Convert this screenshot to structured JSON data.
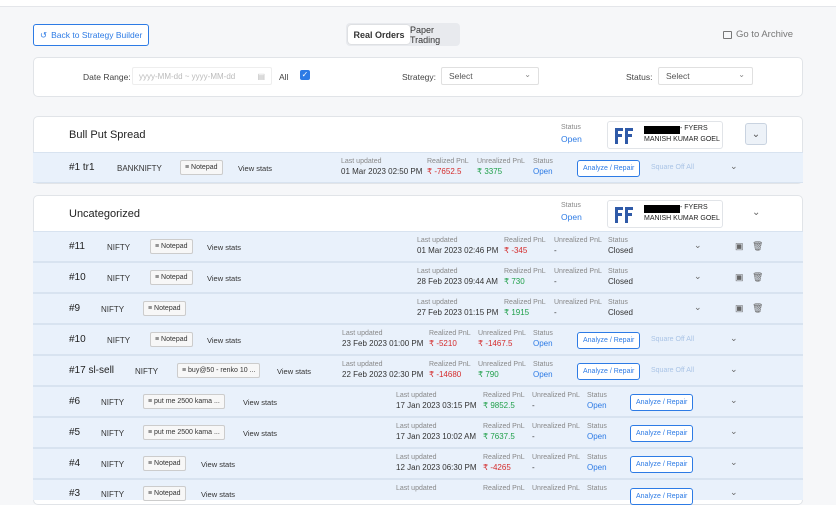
{
  "header": {
    "back_label": "Back to Strategy Builder",
    "tabs": [
      "Real Orders",
      "Paper Trading"
    ],
    "archive_label": "Go to Archive"
  },
  "filters": {
    "date_label": "Date Range:",
    "date_placeholder": "yyyy-MM-dd ~ yyyy-MM-dd",
    "all_label": "All",
    "strategy_label": "Strategy:",
    "strategy_value": "Select",
    "status_label": "Status:",
    "status_value": "Select"
  },
  "groups": [
    {
      "title": "Bull Put Spread",
      "status_label": "Status",
      "status": "Open",
      "broker_1": "- FYERS",
      "broker_2": "MANISH KUMAR GOEL"
    },
    {
      "title": "Uncategorized",
      "status_label": "Status",
      "status": "Open",
      "broker_1": "- FYERS",
      "broker_2": "MANISH KUMAR GOEL"
    }
  ],
  "labels": {
    "last_updated": "Last updated",
    "realized": "Realized PnL",
    "unrealized": "Unrealized PnL",
    "status": "Status",
    "view_stats": "View stats",
    "analyze": "Analyze / Repair",
    "square_off": "Square Off All"
  },
  "rows": [
    {
      "id": "#1 tr1",
      "sym": "BANKNIFTY",
      "note": "Notepad",
      "date": "01 Mar 2023 02:50 PM",
      "realized": "₹ -7652.5",
      "unrealized": "₹ 3375",
      "status": "Open"
    },
    {
      "id": "#11",
      "sym": "NIFTY",
      "note": "Notepad",
      "date": "01 Mar 2023 02:46 PM",
      "realized": "₹ -345",
      "unrealized": "-",
      "status": "Closed"
    },
    {
      "id": "#10",
      "sym": "NIFTY",
      "note": "Notepad",
      "date": "28 Feb 2023 09:44 AM",
      "realized": "₹ 730",
      "unrealized": "-",
      "status": "Closed"
    },
    {
      "id": "#9",
      "sym": "NIFTY",
      "note": "Notepad",
      "date": "27 Feb 2023 01:15 PM",
      "realized": "₹ 1915",
      "unrealized": "-",
      "status": "Closed"
    },
    {
      "id": "#10",
      "sym": "NIFTY",
      "note": "Notepad",
      "date": "23 Feb 2023 01:00 PM",
      "realized": "₹ -5210",
      "unrealized": "₹ -1467.5",
      "status": "Open"
    },
    {
      "id": "#17 sl-sell",
      "sym": "NIFTY",
      "note": "buy@50 - renko 10 ...",
      "date": "22 Feb 2023 02:30 PM",
      "realized": "₹ -14680",
      "unrealized": "₹ 790",
      "status": "Open"
    },
    {
      "id": "#6",
      "sym": "NIFTY",
      "note": "put me 2500 kama ...",
      "date": "17 Jan 2023 03:15 PM",
      "realized": "₹ 9852.5",
      "unrealized": "-",
      "status": "Open"
    },
    {
      "id": "#5",
      "sym": "NIFTY",
      "note": "put me 2500 kama ...",
      "date": "17 Jan 2023 10:02 AM",
      "realized": "₹ 7637.5",
      "unrealized": "-",
      "status": "Open"
    },
    {
      "id": "#4",
      "sym": "NIFTY",
      "note": "Notepad",
      "date": "12 Jan 2023 06:30 PM",
      "realized": "₹ -4265",
      "unrealized": "-",
      "status": "Open"
    },
    {
      "id": "#3",
      "sym": "NIFTY",
      "note": "Notepad",
      "date": "",
      "realized": "",
      "unrealized": "",
      "status": ""
    }
  ]
}
